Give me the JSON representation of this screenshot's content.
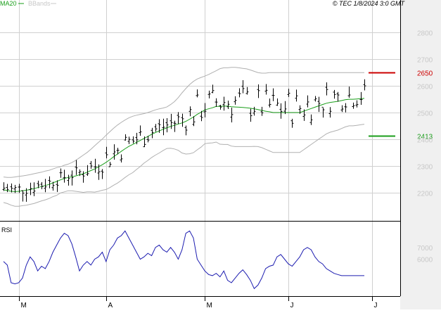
{
  "header": {
    "legend_ma": "MA20",
    "legend_bb": "BBands",
    "copyright": "© TEC 1/8/2024 3:0 GMT"
  },
  "colors": {
    "price": "#000000",
    "ma": "#1a9e1a",
    "bbands": "#b0b0b0",
    "rsi": "#1c1cb0",
    "marker_high": "#cc0000",
    "marker_low": "#1a9e1a",
    "grid": "#d0d0d0",
    "tick_text": "#c8c8c8",
    "right_band": "#f0f0f0"
  },
  "chart_data": [
    {
      "type": "ohlc",
      "title": "",
      "ylim": [
        2130,
        2870
      ],
      "y_ticks": [
        2200,
        2300,
        2400,
        2500,
        2600,
        2700,
        2800
      ],
      "y_tick_labels": [
        "2200",
        "2300",
        "2400",
        "2500",
        "2600",
        "2700",
        "2800"
      ],
      "x_labels": [
        "M",
        "A",
        "M",
        "J",
        "J",
        "A"
      ],
      "x_label_index": [
        4,
        27,
        53,
        75,
        97,
        122
      ],
      "grid": true,
      "series": [
        {
          "name": "MA20",
          "kind": "line",
          "values": [
            2210,
            2207,
            2204,
            2203,
            2204,
            2206,
            2208,
            2211,
            2214,
            2218,
            2222,
            2226,
            2230,
            2236,
            2241,
            2247,
            2252,
            2256,
            2259,
            2262,
            2266,
            2270,
            2276,
            2282,
            2288,
            2296,
            2304,
            2313,
            2323,
            2334,
            2344,
            2354,
            2364,
            2373,
            2380,
            2388,
            2395,
            2403,
            2410,
            2418,
            2425,
            2431,
            2437,
            2443,
            2448,
            2452,
            2457,
            2461,
            2467,
            2475,
            2483,
            2493,
            2501,
            2510,
            2514,
            2518,
            2523,
            2523,
            2524,
            2524,
            2522,
            2521,
            2520,
            2519,
            2518,
            2516,
            2514,
            2511,
            2508,
            2505,
            2503,
            2500,
            2500,
            2500,
            2500,
            2500,
            2500,
            2500,
            2500,
            2505,
            2510,
            2515,
            2520,
            2525,
            2530,
            2535,
            2538,
            2540,
            2542,
            2545,
            2548,
            2550,
            2550,
            2551,
            2552,
            2553
          ]
        },
        {
          "name": "BB upper",
          "kind": "line",
          "values": [
            2258,
            2256,
            2256,
            2258,
            2260,
            2262,
            2264,
            2267,
            2270,
            2273,
            2276,
            2280,
            2283,
            2288,
            2293,
            2296,
            2302,
            2306,
            2312,
            2320,
            2330,
            2340,
            2350,
            2362,
            2375,
            2388,
            2400,
            2415,
            2428,
            2441,
            2453,
            2463,
            2472,
            2480,
            2486,
            2490,
            2493,
            2496,
            2500,
            2505,
            2510,
            2514,
            2517,
            2521,
            2530,
            2541,
            2556,
            2574,
            2590,
            2605,
            2617,
            2626,
            2632,
            2637,
            2643,
            2650,
            2657,
            2665,
            2668,
            2668,
            2670,
            2670,
            2668,
            2666,
            2664,
            2660,
            2655,
            2650,
            2648,
            2648,
            2650,
            2650,
            2650,
            2650,
            2650,
            2650,
            2650,
            2650,
            2650,
            2650,
            2650,
            2650,
            2650,
            2650,
            2650,
            2650,
            2650,
            2650,
            2650,
            2650,
            2650,
            2650,
            2650,
            2650,
            2650,
            2650
          ]
        },
        {
          "name": "BB lower",
          "kind": "line",
          "values": [
            2162,
            2158,
            2152,
            2148,
            2148,
            2150,
            2152,
            2155,
            2158,
            2163,
            2168,
            2172,
            2177,
            2184,
            2189,
            2198,
            2202,
            2206,
            2206,
            2204,
            2202,
            2200,
            2202,
            2202,
            2201,
            2204,
            2208,
            2211,
            2218,
            2227,
            2235,
            2245,
            2256,
            2266,
            2274,
            2286,
            2297,
            2310,
            2320,
            2331,
            2340,
            2348,
            2357,
            2365,
            2366,
            2363,
            2358,
            2348,
            2344,
            2345,
            2349,
            2360,
            2370,
            2383,
            2385,
            2386,
            2389,
            2381,
            2380,
            2380,
            2374,
            2372,
            2372,
            2372,
            2372,
            2372,
            2373,
            2372,
            2368,
            2362,
            2356,
            2350,
            2350,
            2350,
            2350,
            2350,
            2350,
            2350,
            2350,
            2360,
            2370,
            2380,
            2390,
            2400,
            2410,
            2420,
            2426,
            2430,
            2434,
            2440,
            2446,
            2450,
            2450,
            2452,
            2454,
            2456
          ]
        },
        {
          "name": "RSI",
          "kind": "line",
          "panel": "rsi",
          "values": [
            58,
            55,
            40,
            39,
            40,
            44,
            55,
            62,
            58,
            50,
            54,
            52,
            58,
            66,
            72,
            78,
            82,
            80,
            73,
            62,
            50,
            55,
            58,
            55,
            60,
            62,
            66,
            58,
            68,
            72,
            78,
            80,
            84,
            78,
            72,
            66,
            60,
            62,
            65,
            63,
            70,
            72,
            68,
            66,
            70,
            66,
            60,
            68,
            82,
            84,
            78,
            60,
            55,
            50,
            47,
            46,
            48,
            45,
            50,
            42,
            40,
            44,
            48,
            51,
            47,
            42,
            35,
            38,
            44,
            52,
            54,
            55,
            62,
            64,
            60,
            56,
            54,
            58,
            62,
            68,
            70,
            68,
            62,
            58,
            56,
            52,
            50,
            48,
            47,
            46,
            46,
            46,
            46,
            46,
            46,
            46
          ]
        }
      ],
      "markers": [
        {
          "name": "2650",
          "value": 2650
        },
        {
          "name": "2413",
          "value": 2413
        }
      ]
    },
    {
      "type": "line",
      "title": "RSI",
      "ylim": [
        34,
        86
      ],
      "y_ticks": [
        60,
        70
      ],
      "y_tick_labels": [
        "6000",
        "7000"
      ],
      "grid": false
    }
  ]
}
